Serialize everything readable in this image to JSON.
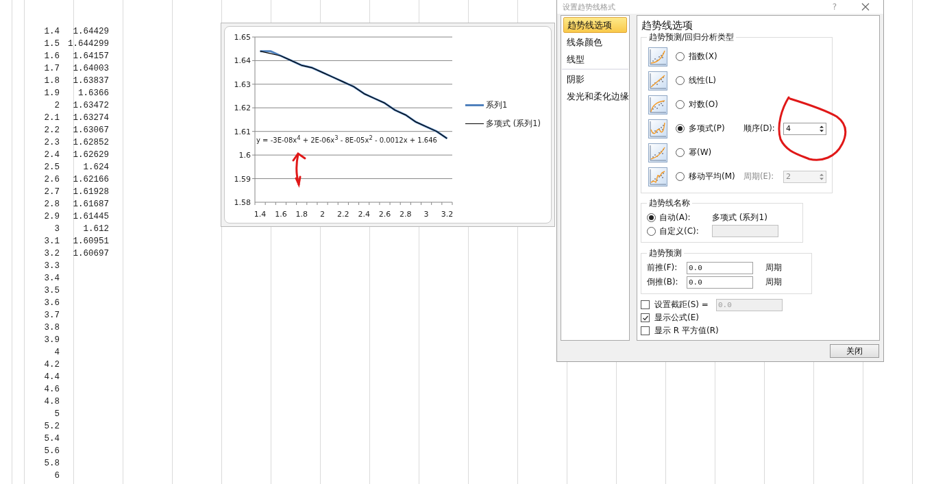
{
  "sheet": {
    "rows": [
      {
        "a": "1.4",
        "b": "1.64429"
      },
      {
        "a": "1.5",
        "b": "1.644299"
      },
      {
        "a": "1.6",
        "b": "1.64157"
      },
      {
        "a": "1.7",
        "b": "1.64003"
      },
      {
        "a": "1.8",
        "b": "1.63837"
      },
      {
        "a": "1.9",
        "b": "1.6366"
      },
      {
        "a": "2",
        "b": "1.63472"
      },
      {
        "a": "2.1",
        "b": "1.63274"
      },
      {
        "a": "2.2",
        "b": "1.63067"
      },
      {
        "a": "2.3",
        "b": "1.62852"
      },
      {
        "a": "2.4",
        "b": "1.62629"
      },
      {
        "a": "2.5",
        "b": "1.624"
      },
      {
        "a": "2.6",
        "b": "1.62166"
      },
      {
        "a": "2.7",
        "b": "1.61928"
      },
      {
        "a": "2.8",
        "b": "1.61687"
      },
      {
        "a": "2.9",
        "b": "1.61445"
      },
      {
        "a": "3",
        "b": "1.612"
      },
      {
        "a": "3.1",
        "b": "1.60951"
      },
      {
        "a": "3.2",
        "b": "1.60697"
      },
      {
        "a": "3.3"
      },
      {
        "a": "3.4"
      },
      {
        "a": "3.5"
      },
      {
        "a": "3.6"
      },
      {
        "a": "3.7"
      },
      {
        "a": "3.8"
      },
      {
        "a": "3.9"
      },
      {
        "a": "4"
      },
      {
        "a": "4.2"
      },
      {
        "a": "4.4"
      },
      {
        "a": "4.6"
      },
      {
        "a": "4.8"
      },
      {
        "a": "5"
      },
      {
        "a": "5.2"
      },
      {
        "a": "5.4"
      },
      {
        "a": "5.6"
      },
      {
        "a": "5.8"
      },
      {
        "a": "6"
      }
    ]
  },
  "chart": {
    "equation": "y = -3E-08x$^{4}$ + 2E-06x$^{3}$ - 8E-05x$^{2}$ - 0.0012x + 1.646",
    "chart_data": {
      "type": "line",
      "x": [
        1.4,
        1.5,
        1.6,
        1.7,
        1.8,
        1.9,
        2,
        2.1,
        2.2,
        2.3,
        2.4,
        2.5,
        2.6,
        2.7,
        2.8,
        2.9,
        3,
        3.1,
        3.2
      ],
      "series": [
        {
          "name": "系列1",
          "color": "#4f81bd",
          "values": [
            1.644,
            1.644,
            1.642,
            1.64,
            1.638,
            1.637,
            1.635,
            1.633,
            1.631,
            1.629,
            1.626,
            1.624,
            1.622,
            1.619,
            1.617,
            1.614,
            1.612,
            1.61,
            1.607
          ]
        },
        {
          "name": "多项式 (系列1)",
          "color": "#000000",
          "values": [
            1.644,
            1.643,
            1.642,
            1.64,
            1.638,
            1.637,
            1.635,
            1.633,
            1.631,
            1.629,
            1.626,
            1.624,
            1.622,
            1.619,
            1.617,
            1.614,
            1.612,
            1.61,
            1.607
          ]
        }
      ],
      "grid": true,
      "legend": "right",
      "xlim": [
        1.35,
        3.25
      ],
      "ylim": [
        1.58,
        1.65
      ],
      "yticks": [
        1.58,
        1.59,
        1.6,
        1.61,
        1.62,
        1.63,
        1.64,
        1.65
      ],
      "xticks": [
        1.4,
        1.6,
        1.8,
        2,
        2.2,
        2.4,
        2.6,
        2.8,
        3,
        3.2
      ]
    }
  },
  "dialog": {
    "title": "设置趋势线格式",
    "help": "?",
    "nav": [
      {
        "label": "趋势线选项",
        "selected": true
      },
      {
        "label": "线条颜色",
        "selected": false
      },
      {
        "label": "线型",
        "selected": false
      },
      {
        "label": "阴影",
        "selected": false
      },
      {
        "label": "发光和柔化边缘",
        "selected": false
      }
    ],
    "heading": "趋势线选项",
    "type_group": {
      "title": "趋势预测/回归分析类型",
      "options": [
        {
          "kind": "exponential",
          "label": "指数(X)",
          "selected": false
        },
        {
          "kind": "linear",
          "label": "线性(L)",
          "selected": false
        },
        {
          "kind": "log",
          "label": "对数(O)",
          "selected": false
        },
        {
          "kind": "polynomial",
          "label": "多项式(P)",
          "selected": true,
          "extra": {
            "label": "顺序(D):",
            "value": "4"
          }
        },
        {
          "kind": "power",
          "label": "幂(W)",
          "selected": false
        },
        {
          "kind": "moving",
          "label": "移动平均(M)",
          "selected": false,
          "extra": {
            "label": "周期(E):",
            "value": "2"
          }
        }
      ]
    },
    "name_group": {
      "title": "趋势线名称",
      "options": [
        {
          "kind": "auto",
          "label": "自动(A):",
          "selected": true,
          "value": "多项式 (系列1)"
        },
        {
          "kind": "custom",
          "label": "自定义(C):",
          "selected": false
        }
      ]
    },
    "forecast": {
      "title": "趋势预测",
      "rows": [
        {
          "label": "前推(F):",
          "value": "0.0",
          "unit": "周期"
        },
        {
          "label": "倒推(B):",
          "value": "0.0",
          "unit": "周期"
        }
      ]
    },
    "checks": [
      {
        "label": "设置截距(S) =",
        "checked": false,
        "field": "0.0"
      },
      {
        "label": "显示公式(E)",
        "checked": true
      },
      {
        "label": "显示 R 平方值(R)",
        "checked": false
      }
    ],
    "close_button": "关闭"
  }
}
